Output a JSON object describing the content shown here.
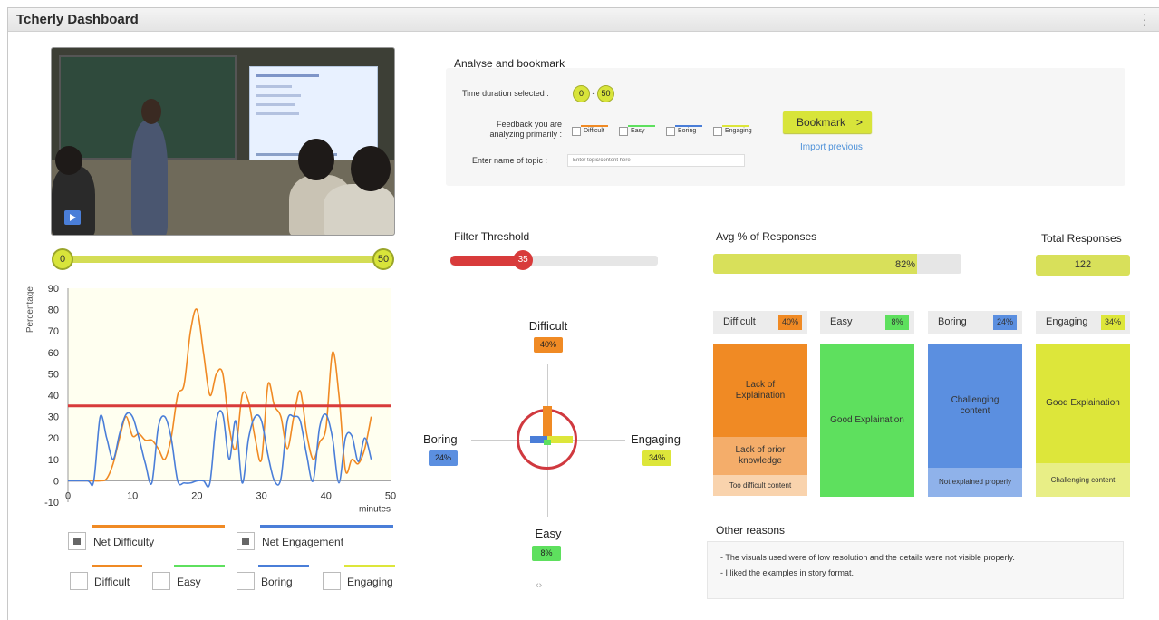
{
  "app": {
    "title": "Tcherly Dashboard"
  },
  "video": {
    "play_icon": "play-icon"
  },
  "range": {
    "start": "0",
    "end": "50"
  },
  "chart_data": {
    "type": "line",
    "xlabel": "minutes",
    "ylabel": "Percentage",
    "xlim": [
      0,
      50
    ],
    "ylim": [
      -10,
      90
    ],
    "xticks": [
      "0",
      "10",
      "20",
      "30",
      "40",
      "50"
    ],
    "yticks": [
      "-10",
      "0",
      "10",
      "20",
      "30",
      "40",
      "50",
      "60",
      "70",
      "80",
      "90"
    ],
    "threshold": 35,
    "series": [
      {
        "name": "Net Difficulty",
        "color": "#f08a24",
        "x": [
          0,
          3,
          5,
          6,
          7,
          8,
          9,
          10,
          11,
          12,
          13,
          14,
          15,
          16,
          17,
          18,
          19,
          20,
          21,
          22,
          23,
          24,
          25,
          26,
          27,
          28,
          29,
          30,
          31,
          32,
          33,
          34,
          35,
          36,
          37,
          38,
          39,
          40,
          41,
          42,
          43,
          44,
          45,
          46,
          47
        ],
        "y": [
          0,
          0,
          0,
          1,
          8,
          20,
          30,
          21,
          22,
          19,
          19,
          15,
          10,
          20,
          40,
          45,
          70,
          80,
          60,
          40,
          50,
          50,
          25,
          15,
          40,
          37,
          20,
          10,
          45,
          35,
          30,
          15,
          30,
          42,
          22,
          10,
          18,
          25,
          60,
          40,
          5,
          10,
          8,
          15,
          30
        ]
      },
      {
        "name": "Net Engagement",
        "color": "#4a7ed8",
        "x": [
          0,
          3,
          4,
          5,
          6,
          7,
          8,
          9,
          10,
          11,
          12,
          13,
          14,
          15,
          16,
          17,
          18,
          19,
          20,
          21,
          22,
          23,
          24,
          25,
          26,
          27,
          28,
          29,
          30,
          31,
          32,
          33,
          34,
          35,
          36,
          37,
          38,
          39,
          40,
          41,
          42,
          43,
          44,
          45,
          46,
          47
        ],
        "y": [
          0,
          0,
          0,
          30,
          20,
          10,
          22,
          31,
          30,
          20,
          8,
          -1,
          25,
          30,
          20,
          0,
          -1,
          -1,
          0,
          0,
          -1,
          28,
          31,
          10,
          28,
          -1,
          20,
          30,
          28,
          12,
          0,
          1,
          28,
          30,
          28,
          12,
          0,
          25,
          31,
          20,
          -1,
          20,
          21,
          9,
          20,
          10
        ]
      }
    ]
  },
  "legend": {
    "net_difficulty": "Net Difficulty",
    "net_engagement": "Net Engagement",
    "difficult": "Difficult",
    "easy": "Easy",
    "boring": "Boring",
    "engaging": "Engaging"
  },
  "analyse": {
    "heading": "Analyse and bookmark",
    "time_label": "Time duration selected :",
    "time_start": "0",
    "time_sep": "-",
    "time_end": "50",
    "feedback_label_1": "Feedback you are",
    "feedback_label_2": "analyzing primarily :",
    "checks": [
      "Difficult",
      "Easy",
      "Boring",
      "Engaging"
    ],
    "topic_label": "Enter name of topic :",
    "topic_placeholder": "Enter topic/content here",
    "bookmark_label": "Bookmark",
    "bookmark_icon": "chevron-right-icon",
    "import_label": "Import previous"
  },
  "filter": {
    "heading": "Filter Threshold",
    "value": 35,
    "max": 100,
    "value_label": "35"
  },
  "avg": {
    "heading": "Avg % of Responses",
    "value": 82,
    "value_label": "82%"
  },
  "total": {
    "heading": "Total Responses",
    "value": "122"
  },
  "quadrant": {
    "difficult": "Difficult",
    "difficult_pct": "40%",
    "easy": "Easy",
    "easy_pct": "8%",
    "boring": "Boring",
    "boring_pct": "24%",
    "engaging": "Engaging",
    "engaging_pct": "34%",
    "nav_prev": "‹",
    "nav_next": "›"
  },
  "cards": [
    {
      "name": "Difficult",
      "pct": "40%",
      "color": "#f08a24",
      "segments": [
        "Lack of Explaination",
        "Lack of prior knowledge",
        "Too difficult content"
      ]
    },
    {
      "name": "Easy",
      "pct": "8%",
      "color": "#5ee05e",
      "segments": [
        "Good Explaination"
      ]
    },
    {
      "name": "Boring",
      "pct": "24%",
      "color": "#5b8fe0",
      "segments": [
        "Challenging content",
        "Not explained properly"
      ]
    },
    {
      "name": "Engaging",
      "pct": "34%",
      "color": "#dde63a",
      "segments": [
        "Good Explaination",
        "Challenging content"
      ]
    }
  ],
  "other_reasons": {
    "heading": "Other reasons",
    "items": [
      "- The visuals used were of low resolution and the details were not visible properly.",
      "- I liked the examples in story format."
    ]
  }
}
